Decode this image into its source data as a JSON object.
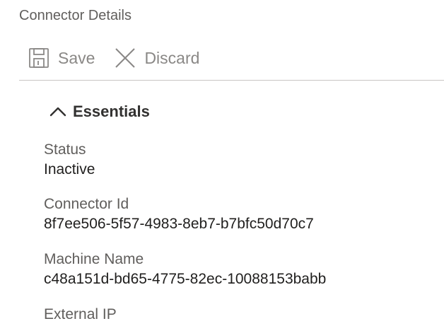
{
  "page": {
    "title": "Connector Details"
  },
  "toolbar": {
    "save_label": "Save",
    "save_icon": "save-icon",
    "discard_label": "Discard",
    "discard_icon": "close-icon"
  },
  "essentials": {
    "header_label": "Essentials",
    "toggle_icon": "chevron-up-icon",
    "fields": [
      {
        "label": "Status",
        "value": "Inactive"
      },
      {
        "label": "Connector Id",
        "value": "8f7ee506-5f57-4983-8eb7-b7bfc50d70c7"
      },
      {
        "label": "Machine Name",
        "value": "c48a151d-bd65-4775-82ec-10088153babb"
      },
      {
        "label": "External IP",
        "value": ""
      }
    ]
  },
  "colors": {
    "toolbar_disabled": "#8a8886",
    "divider": "#c8c6c4",
    "label": "#605e5c",
    "value": "#201f1e"
  }
}
